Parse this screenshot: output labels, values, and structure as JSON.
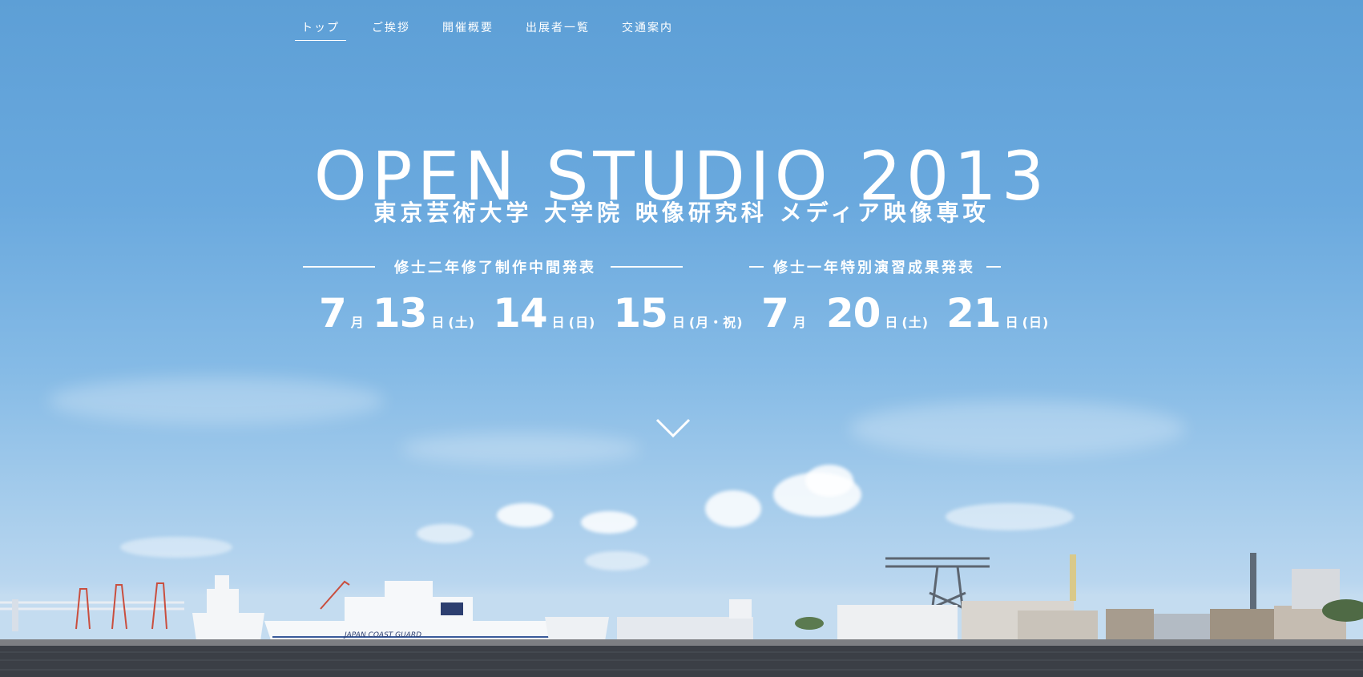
{
  "nav": {
    "items": [
      {
        "label": "トップ",
        "active": true
      },
      {
        "label": "ご挨拶",
        "active": false
      },
      {
        "label": "開催概要",
        "active": false
      },
      {
        "label": "出展者一覧",
        "active": false
      },
      {
        "label": "交通案内",
        "active": false
      }
    ]
  },
  "hero": {
    "title": "OPEN STUDIO 2013",
    "subtitle": "東京芸術大学 大学院 映像研究科 メディア映像専攻"
  },
  "event1": {
    "label": "修士二年修了制作中間発表",
    "month": "7",
    "month_unit": "月",
    "days": [
      {
        "day": "13",
        "unit": "日",
        "weekday": "(土)"
      },
      {
        "day": "14",
        "unit": "日",
        "weekday": "(日)"
      },
      {
        "day": "15",
        "unit": "日",
        "weekday": "(月・祝)"
      }
    ]
  },
  "event2": {
    "label": "修士一年特別演習成果発表",
    "month": "7",
    "month_unit": "月",
    "days": [
      {
        "day": "20",
        "unit": "日",
        "weekday": "(土)"
      },
      {
        "day": "21",
        "unit": "日",
        "weekday": "(日)"
      }
    ]
  },
  "scroll": {
    "icon": "chevron-down-icon"
  },
  "photo": {
    "ship_text": "JAPAN COAST GUARD"
  },
  "colors": {
    "sky_top": "#5d9fd6",
    "sky_bottom": "#c4dcf0",
    "sea": "#3b3f46",
    "text": "#ffffff"
  }
}
